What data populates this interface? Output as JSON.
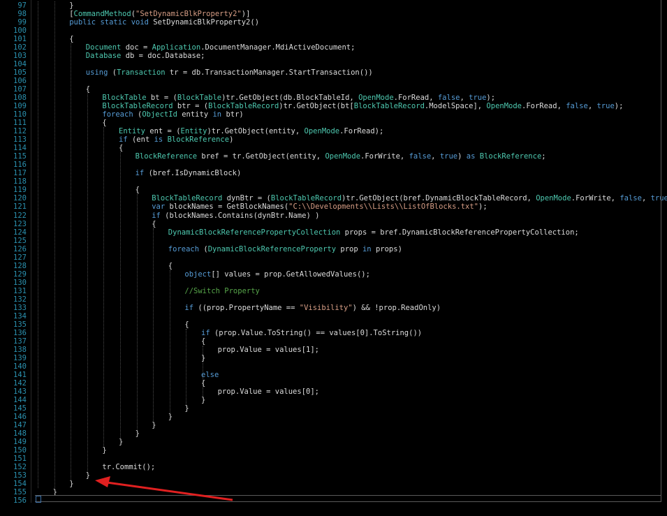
{
  "editor": {
    "first_line": 97,
    "code_lines": [
      {
        "n": 97,
        "indent": 2,
        "t": [
          {
            "c": "p",
            "s": "}"
          }
        ]
      },
      {
        "n": 98,
        "indent": 2,
        "t": [
          {
            "c": "p",
            "s": "["
          },
          {
            "c": "ty",
            "s": "CommandMethod"
          },
          {
            "c": "p",
            "s": "("
          },
          {
            "c": "st",
            "s": "\"SetDynamicBlkProperty2\""
          },
          {
            "c": "p",
            "s": ")]"
          }
        ]
      },
      {
        "n": 99,
        "indent": 2,
        "t": [
          {
            "c": "kw",
            "s": "public static void"
          },
          {
            "c": "p",
            "s": " SetDynamicBlkProperty2()"
          }
        ]
      },
      {
        "n": 100,
        "indent": 2,
        "t": []
      },
      {
        "n": 101,
        "indent": 2,
        "t": [
          {
            "c": "p",
            "s": "{"
          }
        ]
      },
      {
        "n": 102,
        "indent": 3,
        "t": [
          {
            "c": "ty",
            "s": "Document"
          },
          {
            "c": "p",
            "s": " doc = "
          },
          {
            "c": "ty",
            "s": "Application"
          },
          {
            "c": "p",
            "s": ".DocumentManager.MdiActiveDocument;"
          }
        ]
      },
      {
        "n": 103,
        "indent": 3,
        "t": [
          {
            "c": "ty",
            "s": "Database"
          },
          {
            "c": "p",
            "s": " db = doc.Database;"
          }
        ]
      },
      {
        "n": 104,
        "indent": 3,
        "t": []
      },
      {
        "n": 105,
        "indent": 3,
        "t": [
          {
            "c": "kw",
            "s": "using"
          },
          {
            "c": "p",
            "s": " ("
          },
          {
            "c": "ty",
            "s": "Transaction"
          },
          {
            "c": "p",
            "s": " tr = db.TransactionManager.StartTransaction())"
          }
        ]
      },
      {
        "n": 106,
        "indent": 3,
        "t": []
      },
      {
        "n": 107,
        "indent": 3,
        "t": [
          {
            "c": "p",
            "s": "{"
          }
        ]
      },
      {
        "n": 108,
        "indent": 4,
        "t": [
          {
            "c": "ty",
            "s": "BlockTable"
          },
          {
            "c": "p",
            "s": " bt = ("
          },
          {
            "c": "ty",
            "s": "BlockTable"
          },
          {
            "c": "p",
            "s": ")tr.GetObject(db.BlockTableId, "
          },
          {
            "c": "ty",
            "s": "OpenMode"
          },
          {
            "c": "p",
            "s": ".ForRead, "
          },
          {
            "c": "kw",
            "s": "false"
          },
          {
            "c": "p",
            "s": ", "
          },
          {
            "c": "kw",
            "s": "true"
          },
          {
            "c": "p",
            "s": ");"
          }
        ]
      },
      {
        "n": 109,
        "indent": 4,
        "t": [
          {
            "c": "ty",
            "s": "BlockTableRecord"
          },
          {
            "c": "p",
            "s": " btr = ("
          },
          {
            "c": "ty",
            "s": "BlockTableRecord"
          },
          {
            "c": "p",
            "s": ")tr.GetObject(bt["
          },
          {
            "c": "ty",
            "s": "BlockTableRecord"
          },
          {
            "c": "p",
            "s": ".ModelSpace], "
          },
          {
            "c": "ty",
            "s": "OpenMode"
          },
          {
            "c": "p",
            "s": ".ForRead, "
          },
          {
            "c": "kw",
            "s": "false"
          },
          {
            "c": "p",
            "s": ", "
          },
          {
            "c": "kw",
            "s": "true"
          },
          {
            "c": "p",
            "s": ");"
          }
        ]
      },
      {
        "n": 110,
        "indent": 4,
        "t": [
          {
            "c": "kw",
            "s": "foreach"
          },
          {
            "c": "p",
            "s": " ("
          },
          {
            "c": "ty",
            "s": "ObjectId"
          },
          {
            "c": "p",
            "s": " entity "
          },
          {
            "c": "kw",
            "s": "in"
          },
          {
            "c": "p",
            "s": " btr)"
          }
        ]
      },
      {
        "n": 111,
        "indent": 4,
        "t": [
          {
            "c": "p",
            "s": "{"
          }
        ]
      },
      {
        "n": 112,
        "indent": 5,
        "t": [
          {
            "c": "ty",
            "s": "Entity"
          },
          {
            "c": "p",
            "s": " ent = ("
          },
          {
            "c": "ty",
            "s": "Entity"
          },
          {
            "c": "p",
            "s": ")tr.GetObject(entity, "
          },
          {
            "c": "ty",
            "s": "OpenMode"
          },
          {
            "c": "p",
            "s": ".ForRead);"
          }
        ]
      },
      {
        "n": 113,
        "indent": 5,
        "t": [
          {
            "c": "kw",
            "s": "if"
          },
          {
            "c": "p",
            "s": " (ent "
          },
          {
            "c": "kw",
            "s": "is"
          },
          {
            "c": "p",
            "s": " "
          },
          {
            "c": "ty",
            "s": "BlockReference"
          },
          {
            "c": "p",
            "s": ")"
          }
        ]
      },
      {
        "n": 114,
        "indent": 5,
        "t": [
          {
            "c": "p",
            "s": "{"
          }
        ]
      },
      {
        "n": 115,
        "indent": 6,
        "t": [
          {
            "c": "ty",
            "s": "BlockReference"
          },
          {
            "c": "p",
            "s": " bref = tr.GetObject(entity, "
          },
          {
            "c": "ty",
            "s": "OpenMode"
          },
          {
            "c": "p",
            "s": ".ForWrite, "
          },
          {
            "c": "kw",
            "s": "false"
          },
          {
            "c": "p",
            "s": ", "
          },
          {
            "c": "kw",
            "s": "true"
          },
          {
            "c": "p",
            "s": ") "
          },
          {
            "c": "kw",
            "s": "as"
          },
          {
            "c": "p",
            "s": " "
          },
          {
            "c": "ty",
            "s": "BlockReference"
          },
          {
            "c": "p",
            "s": ";"
          }
        ]
      },
      {
        "n": 116,
        "indent": 6,
        "t": []
      },
      {
        "n": 117,
        "indent": 6,
        "t": [
          {
            "c": "kw",
            "s": "if"
          },
          {
            "c": "p",
            "s": " (bref.IsDynamicBlock)"
          }
        ]
      },
      {
        "n": 118,
        "indent": 6,
        "t": []
      },
      {
        "n": 119,
        "indent": 6,
        "t": [
          {
            "c": "p",
            "s": "{"
          }
        ]
      },
      {
        "n": 120,
        "indent": 7,
        "t": [
          {
            "c": "ty",
            "s": "BlockTableRecord"
          },
          {
            "c": "p",
            "s": " dynBtr = ("
          },
          {
            "c": "ty",
            "s": "BlockTableRecord"
          },
          {
            "c": "p",
            "s": ")tr.GetObject(bref.DynamicBlockTableRecord, "
          },
          {
            "c": "ty",
            "s": "OpenMode"
          },
          {
            "c": "p",
            "s": ".ForWrite, "
          },
          {
            "c": "kw",
            "s": "false"
          },
          {
            "c": "p",
            "s": ", "
          },
          {
            "c": "kw",
            "s": "true"
          },
          {
            "c": "p",
            "s": ");"
          }
        ]
      },
      {
        "n": 121,
        "indent": 7,
        "t": [
          {
            "c": "kw",
            "s": "var"
          },
          {
            "c": "p",
            "s": " blockNames = GetBlockNames("
          },
          {
            "c": "st",
            "s": "\"C:\\\\Developments\\\\Lists\\\\ListOfBlocks.txt\""
          },
          {
            "c": "p",
            "s": ");"
          }
        ]
      },
      {
        "n": 122,
        "indent": 7,
        "t": [
          {
            "c": "kw",
            "s": "if"
          },
          {
            "c": "p",
            "s": " (blockNames.Contains(dynBtr.Name) )"
          }
        ]
      },
      {
        "n": 123,
        "indent": 7,
        "t": [
          {
            "c": "p",
            "s": "{"
          }
        ]
      },
      {
        "n": 124,
        "indent": 8,
        "t": [
          {
            "c": "ty",
            "s": "DynamicBlockReferencePropertyCollection"
          },
          {
            "c": "p",
            "s": " props = bref.DynamicBlockReferencePropertyCollection;"
          }
        ]
      },
      {
        "n": 125,
        "indent": 8,
        "t": []
      },
      {
        "n": 126,
        "indent": 8,
        "t": [
          {
            "c": "kw",
            "s": "foreach"
          },
          {
            "c": "p",
            "s": " ("
          },
          {
            "c": "ty",
            "s": "DynamicBlockReferenceProperty"
          },
          {
            "c": "p",
            "s": " prop "
          },
          {
            "c": "kw",
            "s": "in"
          },
          {
            "c": "p",
            "s": " props)"
          }
        ]
      },
      {
        "n": 127,
        "indent": 8,
        "t": []
      },
      {
        "n": 128,
        "indent": 8,
        "t": [
          {
            "c": "p",
            "s": "{"
          }
        ]
      },
      {
        "n": 129,
        "indent": 9,
        "t": [
          {
            "c": "kw",
            "s": "object"
          },
          {
            "c": "p",
            "s": "[] values = prop.GetAllowedValues();"
          }
        ]
      },
      {
        "n": 130,
        "indent": 9,
        "t": []
      },
      {
        "n": 131,
        "indent": 9,
        "t": [
          {
            "c": "cm",
            "s": "//Switch Property"
          }
        ]
      },
      {
        "n": 132,
        "indent": 9,
        "t": []
      },
      {
        "n": 133,
        "indent": 9,
        "t": [
          {
            "c": "kw",
            "s": "if"
          },
          {
            "c": "p",
            "s": " ((prop.PropertyName == "
          },
          {
            "c": "st",
            "s": "\"Visibility\""
          },
          {
            "c": "p",
            "s": ") && !prop.ReadOnly)"
          }
        ]
      },
      {
        "n": 134,
        "indent": 9,
        "t": []
      },
      {
        "n": 135,
        "indent": 9,
        "t": [
          {
            "c": "p",
            "s": "{"
          }
        ]
      },
      {
        "n": 136,
        "indent": 10,
        "t": [
          {
            "c": "kw",
            "s": "if"
          },
          {
            "c": "p",
            "s": " (prop.Value.ToString() == values[0].ToString())"
          }
        ]
      },
      {
        "n": 137,
        "indent": 10,
        "t": [
          {
            "c": "p",
            "s": "{"
          }
        ]
      },
      {
        "n": 138,
        "indent": 11,
        "t": [
          {
            "c": "p",
            "s": "prop.Value = values[1];"
          }
        ]
      },
      {
        "n": 139,
        "indent": 10,
        "t": [
          {
            "c": "p",
            "s": "}"
          }
        ]
      },
      {
        "n": 140,
        "indent": 10,
        "t": []
      },
      {
        "n": 141,
        "indent": 10,
        "t": [
          {
            "c": "kw",
            "s": "else"
          }
        ]
      },
      {
        "n": 142,
        "indent": 10,
        "t": [
          {
            "c": "p",
            "s": "{"
          }
        ]
      },
      {
        "n": 143,
        "indent": 11,
        "t": [
          {
            "c": "p",
            "s": "prop.Value = values[0];"
          }
        ]
      },
      {
        "n": 144,
        "indent": 10,
        "t": [
          {
            "c": "p",
            "s": "}"
          }
        ]
      },
      {
        "n": 145,
        "indent": 9,
        "t": [
          {
            "c": "p",
            "s": "}"
          }
        ]
      },
      {
        "n": 146,
        "indent": 8,
        "t": [
          {
            "c": "p",
            "s": "}"
          }
        ]
      },
      {
        "n": 147,
        "indent": 7,
        "t": [
          {
            "c": "p",
            "s": "}"
          }
        ]
      },
      {
        "n": 148,
        "indent": 6,
        "t": [
          {
            "c": "p",
            "s": "}"
          }
        ]
      },
      {
        "n": 149,
        "indent": 5,
        "t": [
          {
            "c": "p",
            "s": "}"
          }
        ]
      },
      {
        "n": 150,
        "indent": 4,
        "t": [
          {
            "c": "p",
            "s": "}"
          }
        ]
      },
      {
        "n": 151,
        "indent": 4,
        "t": []
      },
      {
        "n": 152,
        "indent": 4,
        "t": [
          {
            "c": "p",
            "s": "tr.Commit();"
          }
        ]
      },
      {
        "n": 153,
        "indent": 3,
        "t": [
          {
            "c": "p",
            "s": "}"
          }
        ]
      },
      {
        "n": 154,
        "indent": 2,
        "t": [
          {
            "c": "p",
            "s": "}"
          }
        ]
      },
      {
        "n": 155,
        "indent": 1,
        "t": [
          {
            "c": "p",
            "s": "}"
          }
        ]
      },
      {
        "n": 156,
        "indent": 0,
        "t": []
      }
    ]
  },
  "colors": {
    "background": "#000000",
    "line_number": "#2b91af",
    "plain": "#dcdcdc",
    "keyword": "#569cd6",
    "type": "#4ec9b0",
    "string": "#d69d85",
    "comment": "#57a64a",
    "annotation_arrow": "#e02020"
  }
}
